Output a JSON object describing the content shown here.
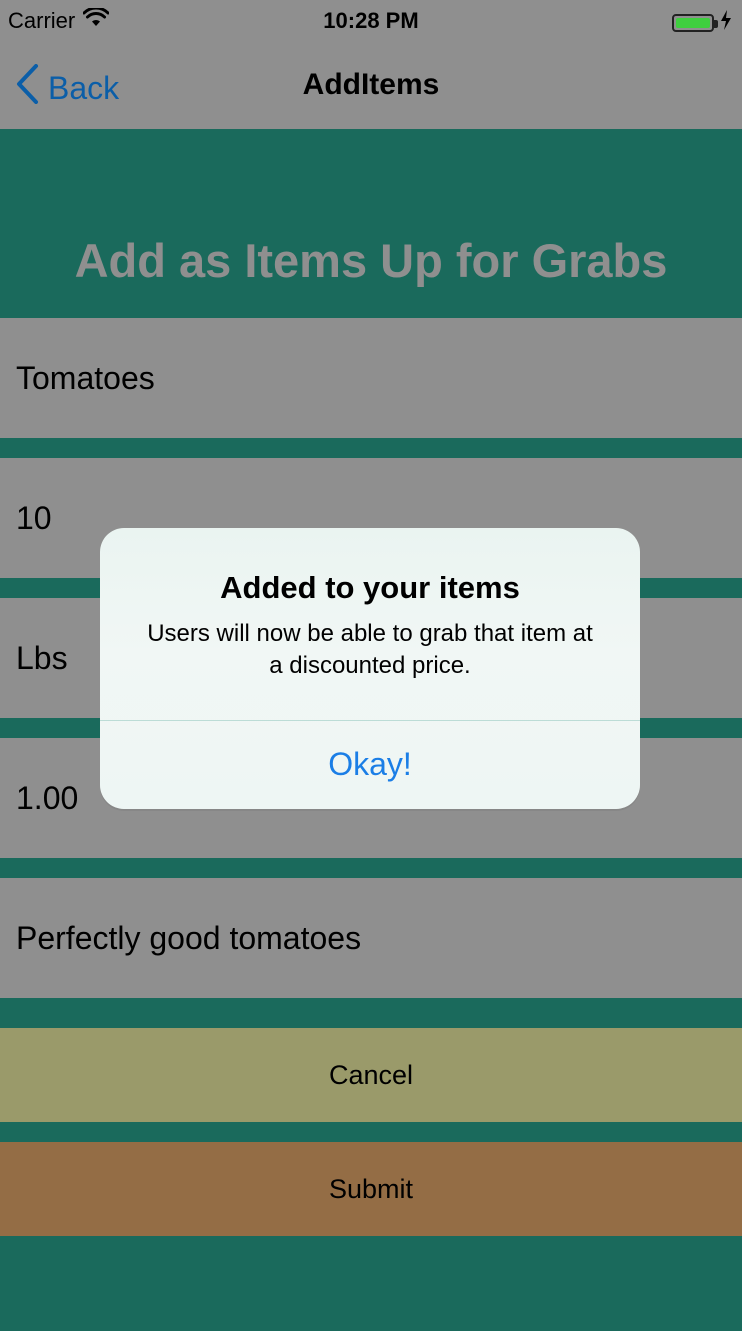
{
  "status_bar": {
    "carrier": "Carrier",
    "time": "10:28 PM"
  },
  "nav": {
    "back_label": "Back",
    "title": "AddItems"
  },
  "header": {
    "title": "Add as Items Up for Grabs"
  },
  "form": {
    "fields": [
      {
        "value": "Tomatoes"
      },
      {
        "value": "10"
      },
      {
        "value": "Lbs"
      },
      {
        "value": "1.00"
      },
      {
        "value": "Perfectly good tomatoes"
      }
    ]
  },
  "buttons": {
    "cancel_label": "Cancel",
    "submit_label": "Submit"
  },
  "alert": {
    "title": "Added to your items",
    "message": "Users will now be able to grab that item at a discounted price.",
    "action_label": "Okay!"
  },
  "colors": {
    "teal": "#1a6a5c",
    "gray": "#8f8f8f",
    "cancel": "#9a9a6a",
    "submit": "#946d45",
    "link_blue": "#1b7ee6"
  }
}
